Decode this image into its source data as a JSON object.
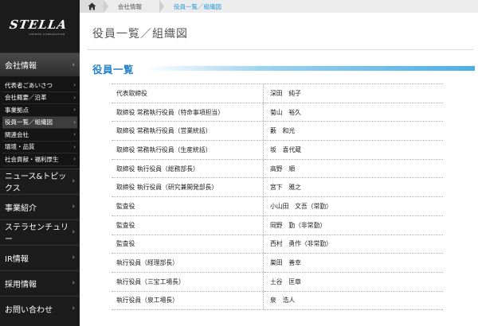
{
  "brand": {
    "logo": "STELLA",
    "logo_sub": "CHEMIFA CORPORATION"
  },
  "sidebar": {
    "sections": [
      {
        "label": "会社情報",
        "active": true,
        "subitems": [
          {
            "label": "代表者ごあいさつ"
          },
          {
            "label": "会社概要／沿革"
          },
          {
            "label": "事業拠点"
          },
          {
            "label": "役員一覧／組織図",
            "current": true
          },
          {
            "label": "関連会社"
          },
          {
            "label": "環境・品質"
          },
          {
            "label": "社会貢献・福利厚生"
          }
        ]
      },
      {
        "label": "ニュース&トピックス"
      },
      {
        "label": "事業紹介"
      },
      {
        "label": "ステラセンチュリー"
      },
      {
        "label": "IR情報"
      },
      {
        "label": "採用情報"
      },
      {
        "label": "お問い合わせ"
      }
    ]
  },
  "breadcrumb": {
    "items": [
      "会社情報",
      "役員一覧／組織図"
    ]
  },
  "page": {
    "title": "役員一覧／組織図",
    "section_title": "役員一覧"
  },
  "officers": [
    {
      "role": "代表取締役",
      "name": "深田　純子"
    },
    {
      "role": "取締役 常務執行役員（特命事項担当）",
      "name": "菊山　裕久"
    },
    {
      "role": "取締役 常務執行役員（営業統括）",
      "name": "藪　和光"
    },
    {
      "role": "取締役 常務執行役員（生産統括）",
      "name": "坂　喜代蔵"
    },
    {
      "role": "取締役 執行役員（総務部長）",
      "name": "高野　順"
    },
    {
      "role": "取締役 執行役員（研究兼開発部長）",
      "name": "宮下　雅之"
    },
    {
      "role": "監査役",
      "name": "小山田　文吾（常勤）"
    },
    {
      "role": "監査役",
      "name": "岡野　勤（非常勤）"
    },
    {
      "role": "監査役",
      "name": "西村　勇作（非常勤）"
    },
    {
      "role": "執行役員（経理部長）",
      "name": "巣田　善幸"
    },
    {
      "role": "執行役員（三宝工場長）",
      "name": "土谷　匡章"
    },
    {
      "role": "執行役員（泉工場長）",
      "name": "泉　浩人"
    }
  ],
  "colors": {
    "accent": "#2a86c9",
    "sidebar_bg": "#1c1c1c",
    "breadcrumb_current": "#2a9ad8"
  }
}
